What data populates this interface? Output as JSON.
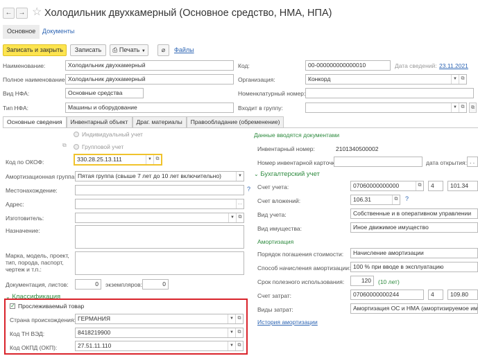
{
  "header": {
    "back": "←",
    "forward": "→",
    "title": "Холодильник двухкамерный (Основное средство, НМА, НПА)"
  },
  "top_tabs": {
    "main": "Основное",
    "docs": "Документы"
  },
  "toolbar": {
    "save_close": "Записать и закрыть",
    "save": "Записать",
    "print": "Печать",
    "files": "Файлы"
  },
  "form": {
    "name_label": "Наименование:",
    "name_value": "Холодильник двухкамерный",
    "full_name_label": "Полное наименование:",
    "full_name_value": "Холодильник двухкамерный",
    "nfa_type_label": "Вид НФА:",
    "nfa_type_value": "Основные средства",
    "nfa_kind_label": "Тип НФА:",
    "nfa_kind_value": "Машины и оборудование",
    "code_label": "Код:",
    "code_value": "00-000000000000010",
    "info_date_label": "Дата сведений:",
    "info_date_value": "23.11.2021",
    "org_label": "Организация:",
    "org_value": "Конкорд",
    "nomen_label": "Номенклатурный номер:",
    "group_label": "Входит в группу:"
  },
  "inner_tabs": [
    "Основные сведения",
    "Инвентарный объект",
    "Драг. материалы",
    "Правообладание (обременение)"
  ],
  "left": {
    "individual": "Индивидуальный учет",
    "group": "Групповой учет",
    "okof_label": "Код по ОКОФ:",
    "okof_value": "330.28.25.13.111",
    "amort_group_label": "Амортизационная группа:",
    "amort_group_value": "Пятая группа (свыше 7 лет до 10 лет включительно)",
    "location_label": "Местонахождение:",
    "address_label": "Адрес:",
    "maker_label": "Изготовитель:",
    "purpose_label": "Назначение:",
    "brand_label": "Марка, модель, проект, тип, порода, паспорт, чертеж и т.п.:",
    "doc_sheets_label": "Документация, листов:",
    "doc_sheets_value": "0",
    "copies_label": "экземпляров:",
    "copies_value": "0",
    "classification": "Классификация",
    "tracked": "Прослеживаемый товар",
    "country_label": "Страна происхождения:",
    "country_value": "ГЕРМАНИЯ",
    "tnved_label": "Код ТН ВЭД:",
    "tnved_value": "8418219900",
    "okpd_label": "Код ОКПД (ОКП):",
    "okpd_value": "27.51.11.110"
  },
  "right": {
    "entered_by_docs": "Данные вводятся документами",
    "inv_num_label": "Инвентарный номер:",
    "inv_num_value": "2101340500002",
    "inv_card_label": "Номер инвентарной карточки:",
    "open_date_label": "дата открытия:",
    "open_date_value": ". .",
    "accounting": "Бухгалтерский учет",
    "account_label": "Счет учета:",
    "account_value": "07060000000000",
    "account_kfo": "4",
    "account_kosgu": "101.34",
    "invest_label": "Счет вложений:",
    "invest_value": "106.31",
    "account_type_label": "Вид учета:",
    "account_type_value": "Собственные и в оперативном управлении",
    "property_label": "Вид имущества:",
    "property_value": "Иное движимое имущество",
    "amortization": "Амортизация",
    "repay_label": "Порядок погашения стоимости:",
    "repay_value": "Начисление амортизации",
    "method_label": "Способ начисления амортизации:",
    "method_value": "100 % при вводе в эксплуатацию",
    "life_label": "Срок полезного использования:",
    "life_value": "120",
    "life_years": "(10 лет)",
    "cost_account_label": "Счет затрат:",
    "cost_account_value": "07060000000244",
    "cost_kfo": "4",
    "cost_kosgu": "109.80",
    "cost_type_label": "Виды затрат:",
    "cost_type_value": "Амортизация ОС и НМА (амортизируемое имуще",
    "history": "История амортизации"
  },
  "colors": {
    "highlight_red": "#d9222a",
    "okof_border": "#f0c32b",
    "primary": "#fde44f",
    "section_green": "#2d8a3e"
  }
}
